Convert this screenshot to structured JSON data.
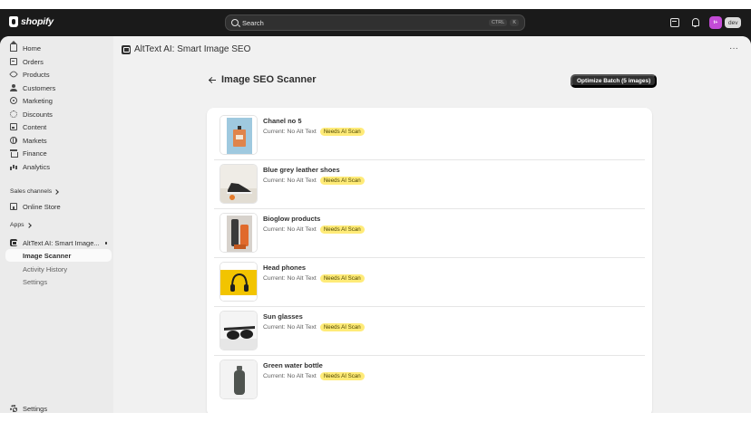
{
  "topbar": {
    "brand": "shopify",
    "search_placeholder": "Search",
    "shortcut_key1": "CTRL",
    "shortcut_key2": "K",
    "avatar_initials": "t+",
    "store_badge": "dev"
  },
  "sidebar": {
    "items": [
      {
        "label": "Home",
        "icon": "home-icon"
      },
      {
        "label": "Orders",
        "icon": "orders-icon"
      },
      {
        "label": "Products",
        "icon": "tag-icon"
      },
      {
        "label": "Customers",
        "icon": "person-icon"
      },
      {
        "label": "Marketing",
        "icon": "target-icon"
      },
      {
        "label": "Discounts",
        "icon": "discount-icon"
      },
      {
        "label": "Content",
        "icon": "content-icon"
      },
      {
        "label": "Markets",
        "icon": "globe-icon"
      },
      {
        "label": "Finance",
        "icon": "bank-icon"
      },
      {
        "label": "Analytics",
        "icon": "chart-icon"
      }
    ],
    "sales_channels_title": "Sales channels",
    "online_store": "Online Store",
    "apps_title": "Apps",
    "app_name": "AltText AI: Smart Image...",
    "app_subitems": [
      "Image Scanner",
      "Activity History",
      "Settings"
    ],
    "settings": "Settings"
  },
  "main": {
    "app_title": "AltText AI: Smart Image SEO",
    "page_title": "Image SEO Scanner",
    "primary_button": "Optimize Batch (5 images)",
    "products": [
      {
        "name": "Chanel no 5",
        "alt": "Current: No Alt Text",
        "badge": "Needs AI Scan"
      },
      {
        "name": "Blue grey leather shoes",
        "alt": "Current: No Alt Text",
        "badge": "Needs AI Scan"
      },
      {
        "name": "Bioglow products",
        "alt": "Current: No Alt Text",
        "badge": "Needs AI Scan"
      },
      {
        "name": "Head phones",
        "alt": "Current: No Alt Text",
        "badge": "Needs AI Scan"
      },
      {
        "name": "Sun glasses",
        "alt": "Current: No Alt Text",
        "badge": "Needs AI Scan"
      },
      {
        "name": "Green water bottle",
        "alt": "Current: No Alt Text",
        "badge": "Needs AI Scan"
      }
    ]
  },
  "colors": {
    "topbar": "#1a1a1a",
    "badge_bg": "#ffeb78",
    "primary_button": "#303030",
    "avatar": "#c34bd6"
  }
}
